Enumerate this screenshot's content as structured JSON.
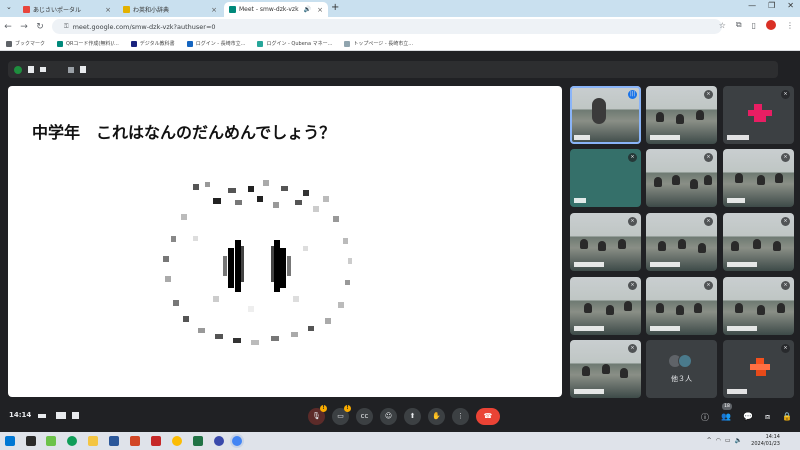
{
  "tabs": [
    {
      "label": "あじさいポータル",
      "color": "#e8453c"
    },
    {
      "label": "わ英和小辞典",
      "color": "#e3b100"
    },
    {
      "label": "Meet - smw-dzk-vzk",
      "color": "#00897b",
      "active": true
    }
  ],
  "omnibox": {
    "url": "meet.google.com/smw-dzk-vzk?authuser=0"
  },
  "bookmarks": [
    {
      "label": "ブックマーク",
      "color": "#5f6368"
    },
    {
      "label": "QRコード作成(無料)/...",
      "color": "#00897b"
    },
    {
      "label": "デジタル教科書",
      "color": "#1a237e"
    },
    {
      "label": "ログイン - 長崎市立...",
      "color": "#1565c0"
    },
    {
      "label": "ログイン - Qubena マネー...",
      "color": "#26a69a"
    },
    {
      "label": "トップページ - 長崎市立...",
      "color": "#90a4ae"
    }
  ],
  "slide": {
    "title": "中学年　これはなんのだんめんでしょう？"
  },
  "others_tile": {
    "label": "他３人"
  },
  "bottom": {
    "time": "14:14",
    "participant_count": "18"
  },
  "taskbar": {
    "time": "14:14",
    "date": "2024/01/23"
  },
  "colors": {
    "meet_bg": "#202124",
    "tile_bg": "#3c4043",
    "end_call": "#ea4335",
    "speaking_ring": "#8ab4f8"
  }
}
